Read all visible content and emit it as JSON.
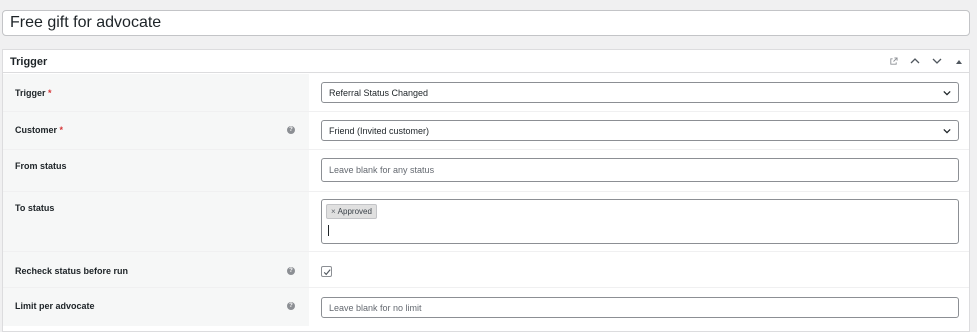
{
  "title_value": "Free gift for advocate",
  "panel": {
    "title": "Trigger",
    "header_icons": [
      "external-link-icon",
      "chevron-up-icon",
      "chevron-down-icon",
      "collapse-triangle-icon"
    ]
  },
  "rows": {
    "trigger": {
      "label": "Trigger",
      "required": "*",
      "value": "Referral Status Changed"
    },
    "customer": {
      "label": "Customer",
      "required": "*",
      "help": "?",
      "value": "Friend (Invited customer)"
    },
    "from_status": {
      "label": "From status",
      "placeholder": "Leave blank for any status"
    },
    "to_status": {
      "label": "To status",
      "tag_remove": "×",
      "tag": "Approved"
    },
    "recheck": {
      "label": "Recheck status before run",
      "help": "?",
      "checked": true
    },
    "limit": {
      "label": "Limit per advocate",
      "help": "?",
      "placeholder": "Leave blank for no limit"
    }
  }
}
